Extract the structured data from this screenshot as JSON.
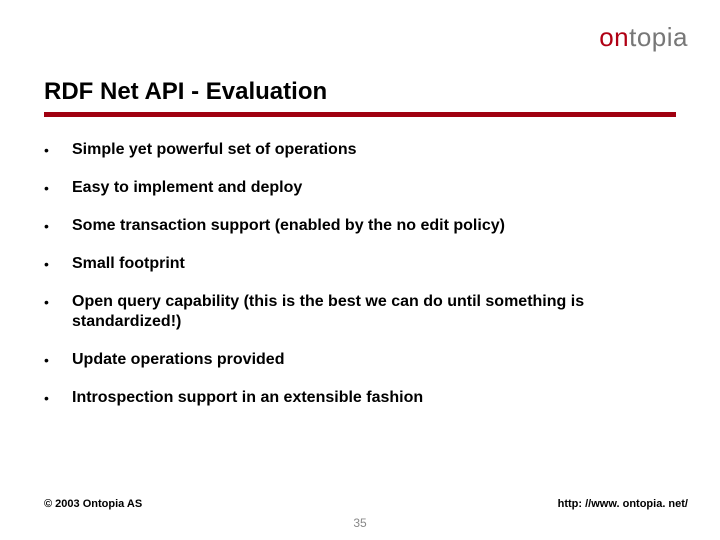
{
  "logo": {
    "part1": "on",
    "part2": "topia"
  },
  "title": "RDF Net API - Evaluation",
  "bullets": [
    "Simple yet powerful set of operations",
    "Easy to implement and deploy",
    "Some transaction support (enabled by the no edit policy)",
    "Small footprint",
    "Open query capability (this is the best we can do until something is standardized!)",
    "Update operations provided",
    "Introspection support in an extensible fashion"
  ],
  "footer": {
    "copyright": "© 2003 Ontopia AS",
    "url": "http: //www. ontopia. net/"
  },
  "page_number": "35"
}
